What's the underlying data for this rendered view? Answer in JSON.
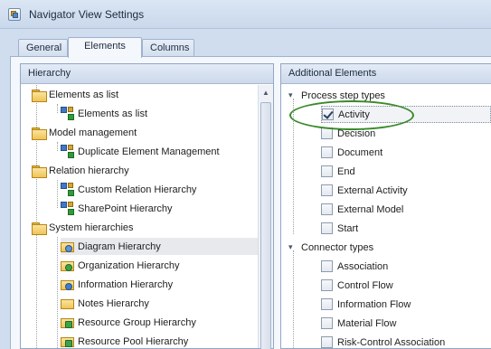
{
  "window": {
    "title": "Navigator View Settings"
  },
  "tabs": [
    {
      "label": "General",
      "active": false
    },
    {
      "label": "Elements",
      "active": true
    },
    {
      "label": "Columns",
      "active": false
    }
  ],
  "hierarchy": {
    "header": "Hierarchy",
    "items": [
      {
        "label": "Elements as list",
        "icon": "folder-icon"
      },
      {
        "label": "Elements as list",
        "icon": "hierarchy-icon"
      },
      {
        "label": "Model management",
        "icon": "folder-icon"
      },
      {
        "label": "Duplicate Element Management",
        "icon": "hierarchy-icon"
      },
      {
        "label": "Relation hierarchy",
        "icon": "folder-icon"
      },
      {
        "label": "Custom Relation Hierarchy",
        "icon": "hierarchy-icon"
      },
      {
        "label": "SharePoint Hierarchy",
        "icon": "hierarchy-icon"
      },
      {
        "label": "System hierarchies",
        "icon": "folder-icon"
      },
      {
        "label": "Diagram Hierarchy",
        "icon": "diagram-hierarchy-icon",
        "selected": true
      },
      {
        "label": "Organization Hierarchy",
        "icon": "organization-hierarchy-icon"
      },
      {
        "label": "Information Hierarchy",
        "icon": "information-hierarchy-icon"
      },
      {
        "label": "Notes Hierarchy",
        "icon": "notes-hierarchy-icon"
      },
      {
        "label": "Resource Group Hierarchy",
        "icon": "resource-group-hierarchy-icon"
      },
      {
        "label": "Resource Pool Hierarchy",
        "icon": "resource-pool-hierarchy-icon"
      }
    ]
  },
  "additional": {
    "header": "Additional Elements",
    "groups": [
      {
        "label": "Process step types",
        "items": [
          {
            "label": "Activity",
            "checked": true
          },
          {
            "label": "Decision",
            "checked": false
          },
          {
            "label": "Document",
            "checked": false
          },
          {
            "label": "End",
            "checked": false
          },
          {
            "label": "External Activity",
            "checked": false
          },
          {
            "label": "External Model",
            "checked": false
          },
          {
            "label": "Start",
            "checked": false
          }
        ]
      },
      {
        "label": "Connector types",
        "items": [
          {
            "label": "Association",
            "checked": false
          },
          {
            "label": "Control Flow",
            "checked": false
          },
          {
            "label": "Information Flow",
            "checked": false
          },
          {
            "label": "Material Flow",
            "checked": false
          },
          {
            "label": "Risk-Control Association",
            "checked": false
          }
        ]
      }
    ]
  },
  "colors": {
    "accent": "#3a8a2b",
    "selection": "#e8e9ec",
    "panel_header": "#ccd9eb"
  }
}
